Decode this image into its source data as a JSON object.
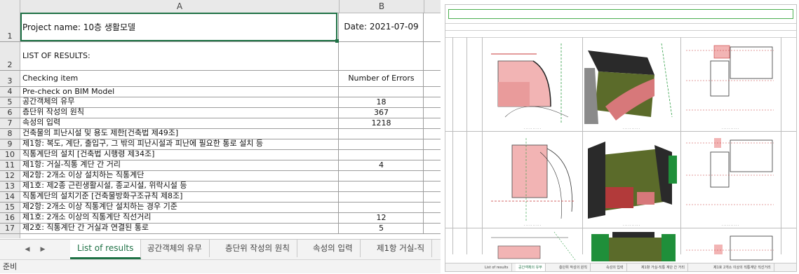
{
  "left_sheet": {
    "columns": [
      "A",
      "B"
    ],
    "rows": [
      {
        "n": "1",
        "a": "Project name: 10층 생활모델",
        "b": "Date: 2021-07-09"
      },
      {
        "n": "2",
        "a": "LIST OF RESULTS:",
        "b": ""
      },
      {
        "n": "3",
        "a": "Checking item",
        "b": "Number of Errors"
      },
      {
        "n": "4",
        "a": "Pre-check on BIM Model",
        "b": ""
      },
      {
        "n": "5",
        "a": "   공간객체의 유무",
        "b": "18"
      },
      {
        "n": "6",
        "a": "   층단위 작성의 원칙",
        "b": "367"
      },
      {
        "n": "7",
        "a": "   속성의 입력",
        "b": "1218"
      },
      {
        "n": "8",
        "a": "건축물의 피난시설 및 용도 제한[건축법 제49조]",
        "b": ""
      },
      {
        "n": "9",
        "a": "   제1항: 복도, 계단, 출입구, 그 밖의 피난시설과 피난에 필요한 통로 설치 등",
        "b": ""
      },
      {
        "n": "10",
        "a": "      직통계단의 설치 [건축법 시행령 제34조]",
        "b": ""
      },
      {
        "n": "11",
        "a": "         제1항: 거실-직통 계단 간 거리",
        "b": "4"
      },
      {
        "n": "12",
        "a": "         제2항: 2개소 이상 설치하는 직통계단",
        "b": ""
      },
      {
        "n": "13",
        "a": "            제1호: 제2종 근린생활시설, 종교시설, 위락시설 등",
        "b": ""
      },
      {
        "n": "14",
        "a": "               직통계단의 설치기준 [건축물방화구조규칙 제8조]",
        "b": ""
      },
      {
        "n": "15",
        "a": "                  제2항: 2개소 이상 직통계단 설치하는 경우 기준",
        "b": ""
      },
      {
        "n": "16",
        "a": "                     제1호: 2개소 이상의 직통계단 직선거리",
        "b": "12"
      },
      {
        "n": "17",
        "a": "                     제2호: 직통계단 간 거실과 연결된 통로",
        "b": "5"
      }
    ],
    "sheet_tabs": [
      "List of results",
      "공간객체의 유무",
      "층단위 작성의 원칙",
      "속성의 입력",
      "제1항 거실-직"
    ],
    "active_tab": "List of results",
    "status": "준비",
    "accent_color": "#1e7145"
  },
  "right_sheet": {
    "sheet_tabs": [
      "List of results",
      "공간객체의 유무",
      "층단위 작성의 원칙",
      "속성의 입력",
      "제1항 거실-직통 계단 간 거리",
      "제1호 2개소 이상의 직통계단 직선거리"
    ],
    "active_tab": "공간객체의 유무"
  }
}
